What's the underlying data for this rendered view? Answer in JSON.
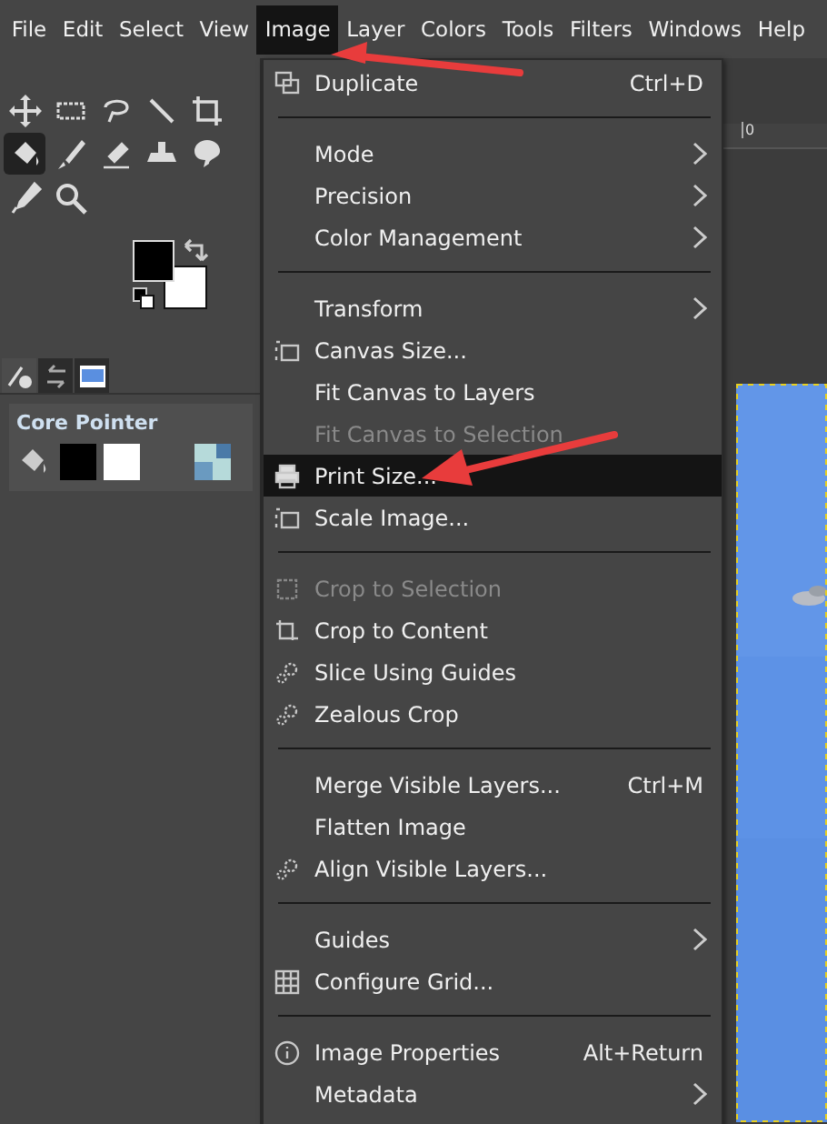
{
  "menubar": [
    {
      "label": "File",
      "selected": false
    },
    {
      "label": "Edit",
      "selected": false
    },
    {
      "label": "Select",
      "selected": false
    },
    {
      "label": "View",
      "selected": false
    },
    {
      "label": "Image",
      "selected": true
    },
    {
      "label": "Layer",
      "selected": false
    },
    {
      "label": "Colors",
      "selected": false
    },
    {
      "label": "Tools",
      "selected": false
    },
    {
      "label": "Filters",
      "selected": false
    },
    {
      "label": "Windows",
      "selected": false
    },
    {
      "label": "Help",
      "selected": false
    }
  ],
  "toolbox": {
    "tools": [
      {
        "selected": false
      },
      {
        "selected": false
      },
      {
        "selected": false
      },
      {
        "selected": false
      },
      {
        "selected": false
      },
      {
        "selected": true
      },
      {
        "selected": false
      },
      {
        "selected": false
      },
      {
        "selected": false
      },
      {
        "selected": false
      },
      {
        "selected": false
      },
      {
        "selected": false
      }
    ],
    "dock_tabs": [
      {
        "selected": true
      },
      {
        "selected": false
      },
      {
        "selected": false
      }
    ],
    "panel": {
      "title": "Core Pointer"
    }
  },
  "ruler": {
    "label": "0"
  },
  "image_menu": [
    {
      "kind": "item",
      "label": "Duplicate",
      "shortcut": "Ctrl+D",
      "submenu": false,
      "disabled": false,
      "selected": false
    },
    {
      "kind": "separator"
    },
    {
      "kind": "item",
      "label": "Mode",
      "submenu": true,
      "disabled": false,
      "selected": false
    },
    {
      "kind": "item",
      "label": "Precision",
      "submenu": true,
      "disabled": false,
      "selected": false
    },
    {
      "kind": "item",
      "label": "Color Management",
      "submenu": true,
      "disabled": false,
      "selected": false
    },
    {
      "kind": "separator"
    },
    {
      "kind": "item",
      "label": "Transform",
      "submenu": true,
      "disabled": false,
      "selected": false
    },
    {
      "kind": "item",
      "label": "Canvas Size...",
      "submenu": false,
      "disabled": false,
      "selected": false
    },
    {
      "kind": "item",
      "label": "Fit Canvas to Layers",
      "submenu": false,
      "disabled": false,
      "selected": false
    },
    {
      "kind": "item",
      "label": "Fit Canvas to Selection",
      "submenu": false,
      "disabled": true,
      "selected": false
    },
    {
      "kind": "item",
      "label": "Print Size...",
      "submenu": false,
      "disabled": false,
      "selected": true
    },
    {
      "kind": "item",
      "label": "Scale Image...",
      "submenu": false,
      "disabled": false,
      "selected": false
    },
    {
      "kind": "separator"
    },
    {
      "kind": "item",
      "label": "Crop to Selection",
      "submenu": false,
      "disabled": true,
      "selected": false
    },
    {
      "kind": "item",
      "label": "Crop to Content",
      "submenu": false,
      "disabled": false,
      "selected": false
    },
    {
      "kind": "item",
      "label": "Slice Using Guides",
      "submenu": false,
      "disabled": false,
      "selected": false
    },
    {
      "kind": "item",
      "label": "Zealous Crop",
      "submenu": false,
      "disabled": false,
      "selected": false
    },
    {
      "kind": "separator"
    },
    {
      "kind": "item",
      "label": "Merge Visible Layers...",
      "shortcut": "Ctrl+M",
      "submenu": false,
      "disabled": false,
      "selected": false
    },
    {
      "kind": "item",
      "label": "Flatten Image",
      "submenu": false,
      "disabled": false,
      "selected": false
    },
    {
      "kind": "item",
      "label": "Align Visible Layers...",
      "submenu": false,
      "disabled": false,
      "selected": false
    },
    {
      "kind": "separator"
    },
    {
      "kind": "item",
      "label": "Guides",
      "submenu": true,
      "disabled": false,
      "selected": false
    },
    {
      "kind": "item",
      "label": "Configure Grid...",
      "submenu": false,
      "disabled": false,
      "selected": false
    },
    {
      "kind": "separator"
    },
    {
      "kind": "item",
      "label": "Image Properties",
      "shortcut": "Alt+Return",
      "submenu": false,
      "disabled": false,
      "selected": false
    },
    {
      "kind": "item",
      "label": "Metadata",
      "submenu": true,
      "disabled": false,
      "selected": false
    }
  ]
}
